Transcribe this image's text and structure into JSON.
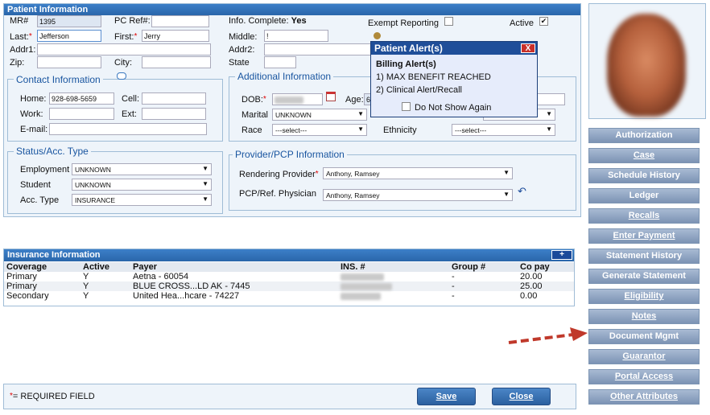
{
  "patient_info": {
    "title": "Patient Information",
    "mr_label": "MR#",
    "mr_value": "1395",
    "pcref_label": "PC Ref#:",
    "pcref_value": "",
    "info_complete_label": "Info. Complete:",
    "info_complete_value": "Yes",
    "exempt_label": "Exempt Reporting",
    "active_label": "Active",
    "active_checked": "✔",
    "last_label": "Last:",
    "last_value": "Jefferson",
    "first_label": "First:",
    "first_value": "Jerry",
    "middle_label": "Middle:",
    "middle_value": "!",
    "addr1_label": "Addr1:",
    "addr2_label": "Addr2:",
    "zip_label": "Zip:",
    "city_label": "City:",
    "state_label": "State",
    "required_star": "*"
  },
  "contact": {
    "title": "Contact Information",
    "home_label": "Home:",
    "home_value": "928-698-5659",
    "cell_label": "Cell:",
    "work_label": "Work:",
    "ext_label": "Ext:",
    "email_label": "E-mail:",
    "email_value": ""
  },
  "additional": {
    "title": "Additional Information",
    "dob_label": "DOB:",
    "age_label": "Age:",
    "age_value": "6",
    "marital_label": "Marital",
    "marital_value": "UNKNOWN",
    "race_label": "Race",
    "race_value": "---select---",
    "ethnicity_label": "Ethnicity",
    "ethnicity_value": "---select---"
  },
  "status": {
    "title": "Status/Acc. Type",
    "employment_label": "Employment",
    "employment_value": "UNKNOWN",
    "student_label": "Student",
    "student_value": "UNKNOWN",
    "acctype_label": "Acc. Type",
    "acctype_value": "INSURANCE"
  },
  "provider": {
    "title": "Provider/PCP Information",
    "rendering_label": "Rendering Provider",
    "rendering_value": "Anthony, Ramsey",
    "pcp_label": "PCP/Ref. Physician",
    "pcp_value": "Anthony, Ramsey"
  },
  "alert": {
    "title": "Patient Alert(s)",
    "close_label": "X",
    "heading": "Billing Alert(s)",
    "line1": "1) MAX BENEFIT REACHED",
    "line2": "2) Clinical Alert/Recall",
    "dont_show_label": "Do Not Show Again"
  },
  "insurance": {
    "title": "Insurance Information",
    "add_label": "+",
    "columns": [
      "Coverage",
      "Active",
      "Payer",
      "INS. #",
      "Group #",
      "Co pay"
    ],
    "rows": [
      {
        "coverage": "Primary",
        "active": "Y",
        "payer": "Aetna - 60054",
        "group": "-",
        "copay": "20.00"
      },
      {
        "coverage": "Primary",
        "active": "Y",
        "payer": "BLUE CROSS...LD AK - 7445",
        "group": "-",
        "copay": "25.00"
      },
      {
        "coverage": "Secondary",
        "active": "Y",
        "payer": "United Hea...hcare - 74227",
        "group": "-",
        "copay": "0.00"
      }
    ]
  },
  "footer": {
    "required_note": "= REQUIRED FIELD",
    "required_star": "*",
    "save_label": "Save",
    "close_label": "Close"
  },
  "sidebar": {
    "items": [
      {
        "label": "Authorization"
      },
      {
        "label": "Case"
      },
      {
        "label": "Schedule History"
      },
      {
        "label": "Ledger"
      },
      {
        "label": "Recalls"
      },
      {
        "label": "Enter Payment"
      },
      {
        "label": "Statement History"
      },
      {
        "label": "Generate Statement"
      },
      {
        "label": "Eligibility"
      },
      {
        "label": "Notes"
      },
      {
        "label": "Document Mgmt"
      },
      {
        "label": "Guarantor"
      },
      {
        "label": "Portal Access"
      },
      {
        "label": "Other Attributes"
      }
    ]
  },
  "colors": {
    "accent": "#2a66aa",
    "sidebar_button": "#8ea3c2",
    "arrow": "#c0392b",
    "panel_bg": "#eef4fa"
  }
}
